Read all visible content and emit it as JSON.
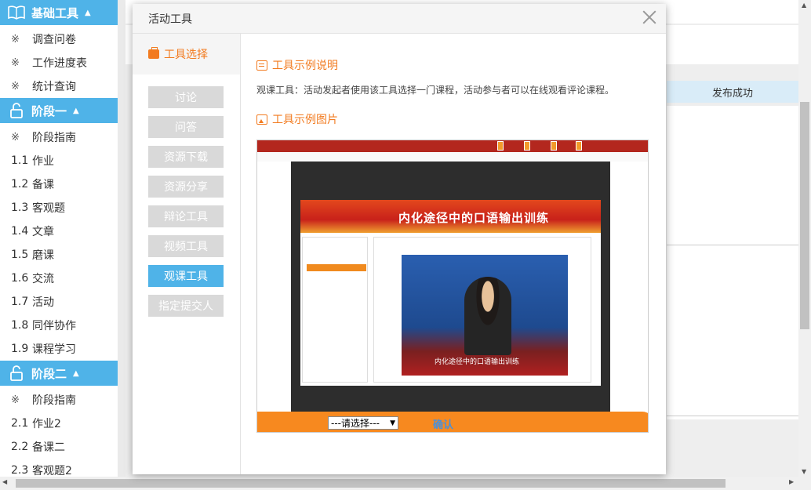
{
  "sidebar": {
    "sections": [
      {
        "title": "基础工具",
        "icon": "book-icon",
        "items": [
          {
            "num": "",
            "mark": "※",
            "label": "调查问卷"
          },
          {
            "num": "",
            "mark": "※",
            "label": "工作进度表"
          },
          {
            "num": "",
            "mark": "※",
            "label": "统计查询"
          }
        ]
      },
      {
        "title": "阶段一",
        "icon": "lock-icon",
        "items": [
          {
            "num": "",
            "mark": "※",
            "label": "阶段指南"
          },
          {
            "num": "1.1",
            "mark": "",
            "label": "作业"
          },
          {
            "num": "1.2",
            "mark": "",
            "label": "备课"
          },
          {
            "num": "1.3",
            "mark": "",
            "label": "客观题"
          },
          {
            "num": "1.4",
            "mark": "",
            "label": "文章"
          },
          {
            "num": "1.5",
            "mark": "",
            "label": "磨课"
          },
          {
            "num": "1.6",
            "mark": "",
            "label": "交流"
          },
          {
            "num": "1.7",
            "mark": "",
            "label": "活动"
          },
          {
            "num": "1.8",
            "mark": "",
            "label": "同伴协作"
          },
          {
            "num": "1.9",
            "mark": "",
            "label": "课程学习"
          }
        ]
      },
      {
        "title": "阶段二",
        "icon": "lock-icon",
        "items": [
          {
            "num": "",
            "mark": "※",
            "label": "阶段指南"
          },
          {
            "num": "2.1",
            "mark": "",
            "label": "作业2"
          },
          {
            "num": "2.2",
            "mark": "",
            "label": "备课二"
          },
          {
            "num": "2.3",
            "mark": "",
            "label": "客观题2"
          }
        ]
      }
    ]
  },
  "background": {
    "success_text": "发布成功"
  },
  "modal": {
    "title": "活动工具",
    "nav_title": "工具选择",
    "tools": [
      "讨论",
      "问答",
      "资源下载",
      "资源分享",
      "辩论工具",
      "视频工具",
      "观课工具",
      "指定提交人"
    ],
    "active_index": 6,
    "section_desc_title": "工具示例说明",
    "description": "观课工具：活动发起者使用该工具选择一门课程，活动参与者可以在线观看评论课程。",
    "section_img_title": "工具示例图片",
    "example": {
      "banner_title": "内化途径中的口语输出训练",
      "video_caption": "内化途径中的口语输出训练",
      "select_value": "---请选择---",
      "confirm_label": "确认"
    }
  }
}
